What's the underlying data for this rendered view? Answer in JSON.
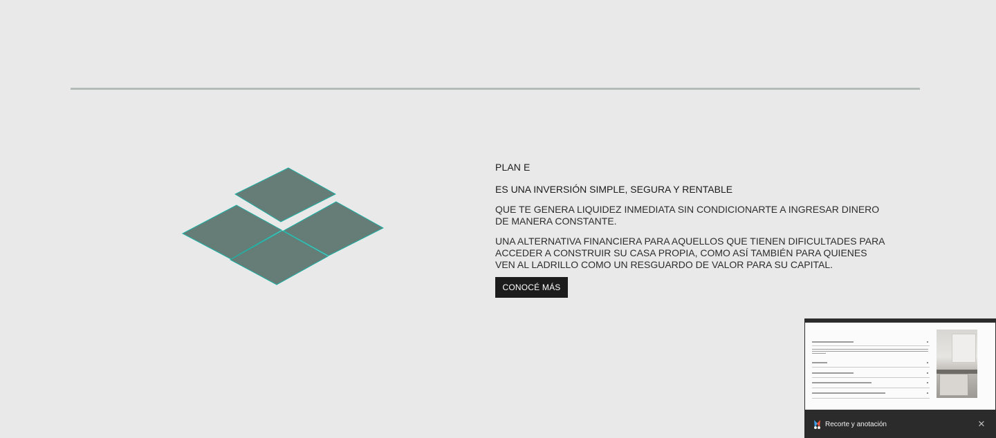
{
  "plan": {
    "title": "PLAN E",
    "subtitle": "ES UNA INVERSIÓN SIMPLE, SEGURA Y RENTABLE",
    "paragraph1": "QUE TE GENERA LIQUIDEZ INMEDIATA SIN CONDICIONARTE A INGRESAR DINERO DE MANERA CONSTANTE.",
    "paragraph2": "UNA ALTERNATIVA FINANCIERA PARA AQUELLOS QUE TIENEN DIFICULTADES PARA ACCEDER A CONSTRUIR SU CASA PROPIA, COMO ASÍ TAMBIÉN PARA QUIENES VEN AL LADRILLO COMO UN RESGUARDO DE VALOR PARA SU CAPITAL.",
    "cta_label": "CONOCÉ MÁS"
  },
  "icons": {
    "tiles": "isometric-tiles-icon",
    "snip_app": "snipping-tool-icon",
    "close": "close-icon"
  },
  "colors": {
    "background": "#e9e9e9",
    "divider": "#b4bcb8",
    "tile_fill": "#657c77",
    "tile_edge": "#1fb3a6",
    "button": "#1c1c1c"
  },
  "snip": {
    "app_label": "Recorte y anotación",
    "close_glyph": "✕"
  }
}
